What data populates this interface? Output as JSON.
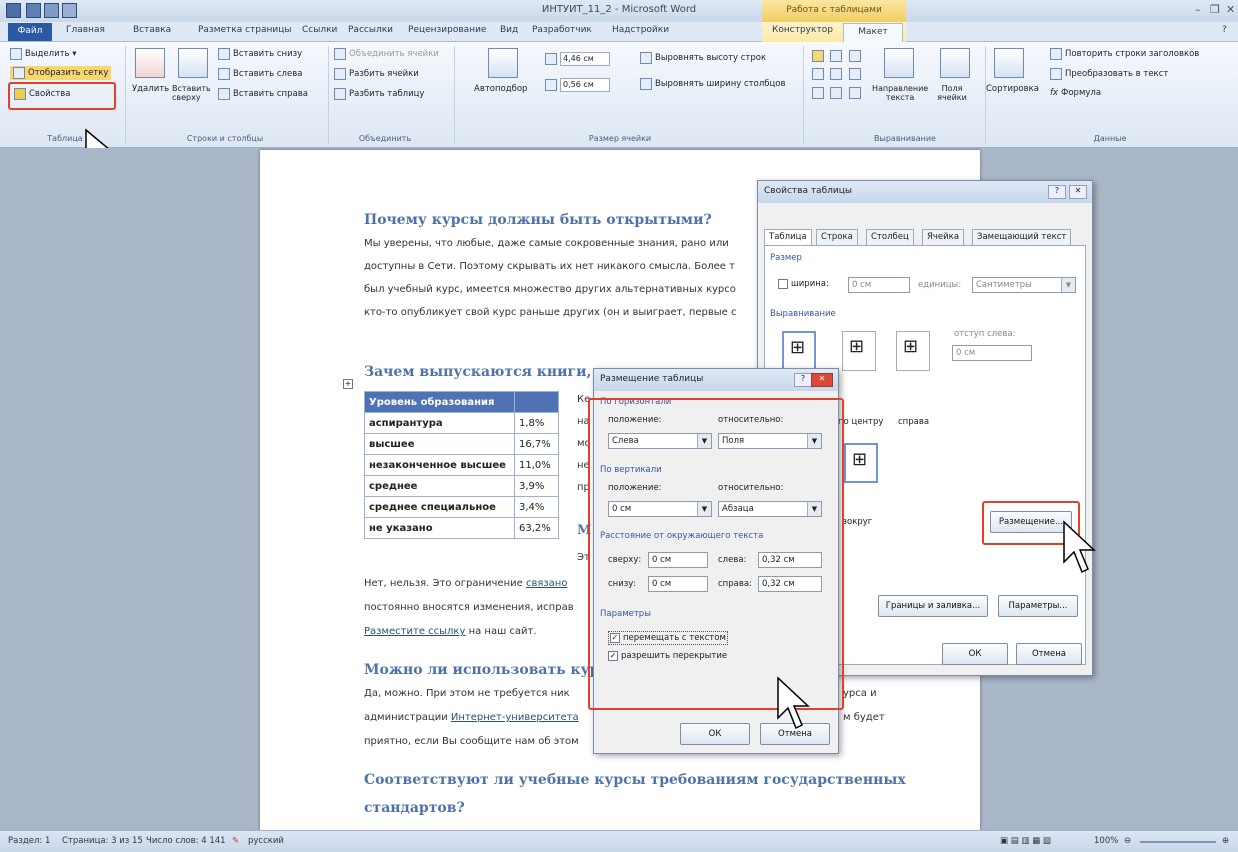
{
  "window": {
    "title": "ИНТУИТ_11_2 - Microsoft Word",
    "context_title": "Работа с таблицами"
  },
  "tabs": [
    "Файл",
    "Главная",
    "Вставка",
    "Разметка страницы",
    "Ссылки",
    "Рассылки",
    "Рецензирование",
    "Вид",
    "Разработчик",
    "Надстройки",
    "Конструктор",
    "Макет"
  ],
  "ribbon": {
    "table": {
      "select": "Выделить ▾",
      "gridlines": "Отобразить сетку",
      "properties": "Свойства",
      "label": "Таблица"
    },
    "rows_cols": {
      "delete": "Удалить",
      "insert_above": "Вставить сверху",
      "insert_below": "Вставить снизу",
      "insert_left": "Вставить слева",
      "insert_right": "Вставить справа",
      "label": "Строки и столбцы"
    },
    "merge": {
      "merge_cells": "Объединить ячейки",
      "split_cells": "Разбить ячейки",
      "split_table": "Разбить таблицу",
      "label": "Объединить"
    },
    "cell_size": {
      "autofit": "Автоподбор",
      "height": "4,46 см",
      "width": "0,56 см",
      "distribute_rows": "Выровнять высоту строк",
      "distribute_cols": "Выровнять ширину столбцов",
      "label": "Размер ячейки"
    },
    "alignment": {
      "direction": "Направление текста",
      "margins": "Поля ячейки",
      "label": "Выравнивание"
    },
    "data": {
      "sort": "Сортировка",
      "repeat_header": "Повторить строки заголовков",
      "convert": "Преобразовать в текст",
      "formula": "Формула",
      "label": "Данные"
    }
  },
  "doc": {
    "h1": "Почему курсы должны быть открытыми?",
    "p1": [
      "Мы уверены, что любые, даже самые сокровенные знания, рано или",
      "доступны в Сети. Поэтому скрывать их нет никакого смысла. Более т",
      "был учебный курс, имеется множество других альтернативных курсо",
      "кто-то опубликует свой курс раньше других (он и выиграет, первые с"
    ],
    "h2": "Зачем выпускаются книги, ес",
    "table_header": "Уровень образования",
    "table_rows": [
      [
        "аспирантура",
        "1,8%"
      ],
      [
        "высшее",
        "16,7%"
      ],
      [
        "незаконченное высшее",
        "11,0%"
      ],
      [
        "среднее",
        "3,9%"
      ],
      [
        "среднее специальное",
        "3,4%"
      ],
      [
        "не указано",
        "63,2%"
      ]
    ],
    "side_text": [
      "Ке",
      "на",
      "мо",
      "не",
      "пр"
    ],
    "side_m1": "М",
    "side_m2": "Эт",
    "p2a": "Нет, нельзя. Это ограничение ",
    "p2link": "связано",
    "p2b": "постоянно вносятся изменения, исправ",
    "p2link2": "Разместите ссылку",
    "p2c": " на наш сайт.",
    "h3": "Можно ли использовать курс",
    "p3a": "Да, можно. При этом не требуется ник",
    "p3a_end": "урса и",
    "p3b": "администрации ",
    "p3link": "Интернет-университета",
    "p3b_end": "м будет",
    "p3c": "приятно, если Вы сообщите нам об этом",
    "h4a": "Соответствуют ли учебные курсы требованиям государственных",
    "h4b": "стандартов?"
  },
  "props_dialog": {
    "title": "Свойства таблицы",
    "tabs": [
      "Таблица",
      "Строка",
      "Столбец",
      "Ячейка",
      "Замещающий текст"
    ],
    "size_label": "Размер",
    "width_label": "ширина:",
    "width_value": "0 см",
    "units_label": "единицы:",
    "units_value": "Сантиметры",
    "alignment_label": "Выравнивание",
    "indent_label": "отступ слева:",
    "indent_value": "0 см",
    "align_center": "по центру",
    "align_right": "справа",
    "wrap_around": "вокруг",
    "positioning_button": "Размещение...",
    "borders_button": "Границы и заливка...",
    "options_button": "Параметры...",
    "ok": "ОК",
    "cancel": "Отмена"
  },
  "pos_dialog": {
    "title": "Размещение таблицы",
    "horizontal": "По горизонтали",
    "h_position_label": "положение:",
    "h_position": "Слева",
    "h_relative_label": "относительно:",
    "h_relative": "Поля",
    "vertical": "По вертикали",
    "v_position_label": "положение:",
    "v_position": "0 см",
    "v_relative_label": "относительно:",
    "v_relative": "Абзаца",
    "distance": "Расстояние от окружающего текста",
    "top_label": "сверху:",
    "top": "0 см",
    "left_label": "слева:",
    "left": "0,32 см",
    "bottom_label": "снизу:",
    "bottom": "0 см",
    "right_label": "справа:",
    "right": "0,32 см",
    "params": "Параметры",
    "move_with_text": "перемещать с текстом",
    "allow_overlap": "разрешить перекрытие",
    "ok": "ОК",
    "cancel": "Отмена"
  },
  "status": {
    "section": "Раздел: 1",
    "page": "Страница: 3 из 15",
    "words": "Число слов: 4 141",
    "lang": "русский",
    "zoom": "100%"
  },
  "colors": {
    "accent": "#2a5aa5",
    "highlight": "#e0412a",
    "heading": "#4f72a8"
  }
}
